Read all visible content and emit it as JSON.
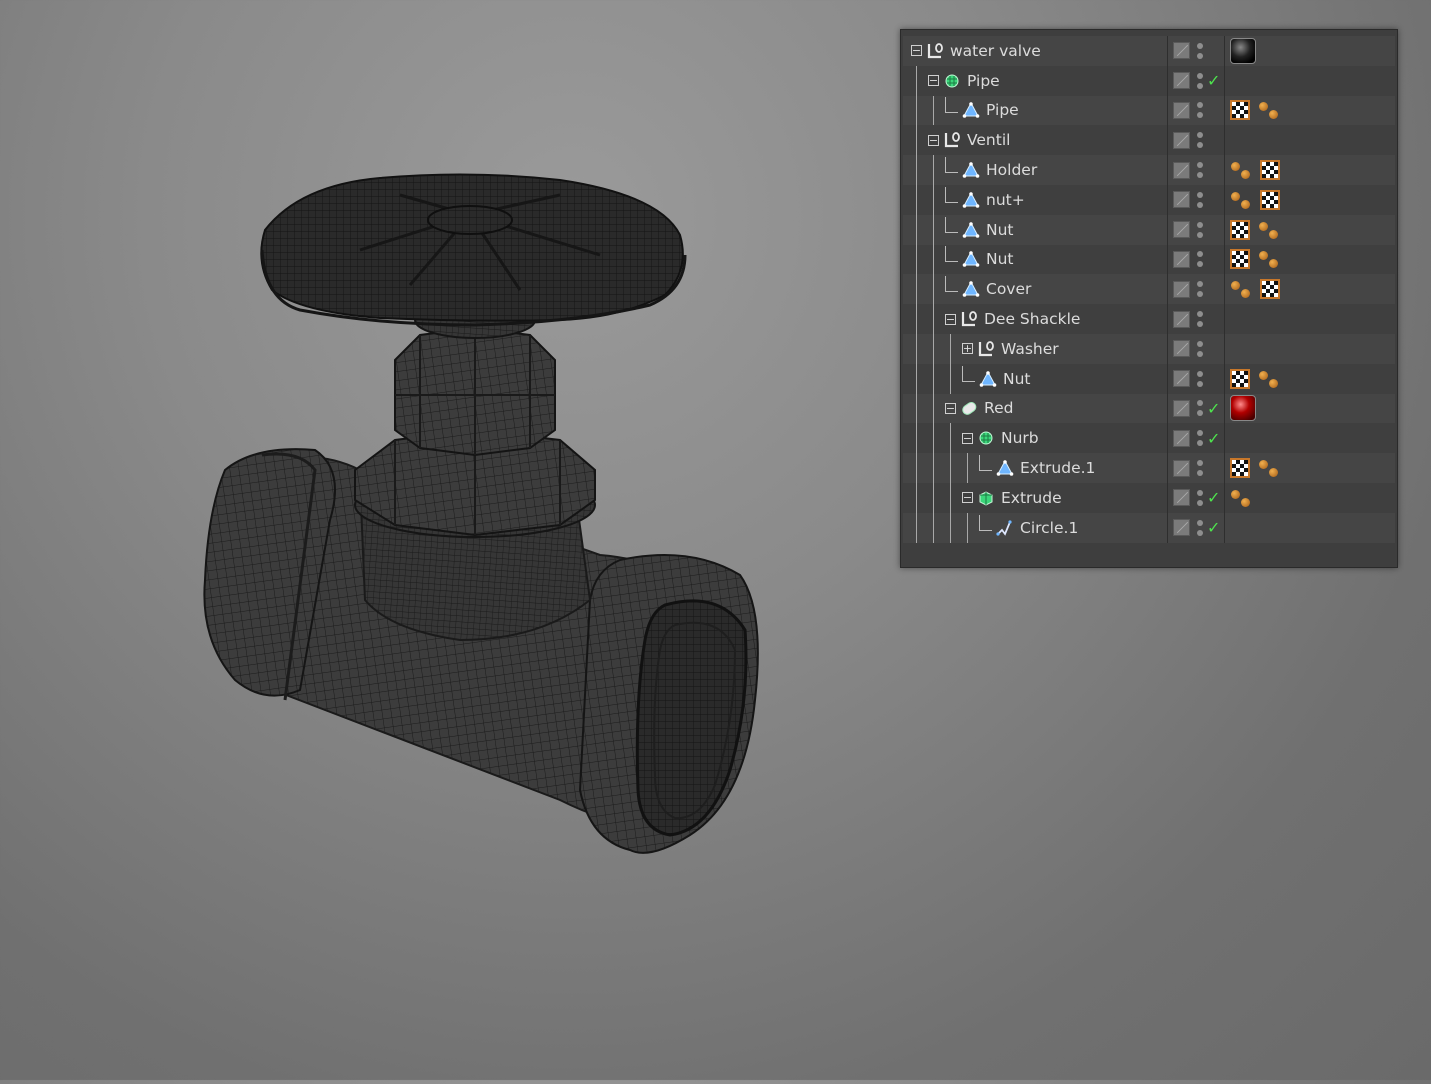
{
  "object_manager": {
    "rows": [
      {
        "label": "water valve",
        "icon": "null-object-icon",
        "depth": 0,
        "expander": "minus",
        "visible_check": false,
        "tags": [
          "material-black"
        ]
      },
      {
        "label": "Pipe",
        "icon": "subdivision-icon",
        "depth": 1,
        "expander": "minus",
        "visible_check": true,
        "tags": []
      },
      {
        "label": "Pipe",
        "icon": "polygon-icon",
        "depth": 2,
        "expander": "none",
        "visible_check": false,
        "tags": [
          "texture",
          "phong"
        ]
      },
      {
        "label": "Ventil",
        "icon": "null-object-icon",
        "depth": 1,
        "expander": "minus",
        "visible_check": false,
        "tags": []
      },
      {
        "label": "Holder",
        "icon": "polygon-icon",
        "depth": 2,
        "expander": "none",
        "visible_check": false,
        "tags": [
          "phong",
          "texture"
        ]
      },
      {
        "label": "nut+",
        "icon": "polygon-icon",
        "depth": 2,
        "expander": "none",
        "visible_check": false,
        "tags": [
          "phong",
          "texture"
        ]
      },
      {
        "label": "Nut",
        "icon": "polygon-icon",
        "depth": 2,
        "expander": "none",
        "visible_check": false,
        "tags": [
          "texture",
          "phong"
        ]
      },
      {
        "label": "Nut",
        "icon": "polygon-icon",
        "depth": 2,
        "expander": "none",
        "visible_check": false,
        "tags": [
          "texture",
          "phong"
        ]
      },
      {
        "label": "Cover",
        "icon": "polygon-icon",
        "depth": 2,
        "expander": "none",
        "visible_check": false,
        "tags": [
          "phong",
          "texture"
        ]
      },
      {
        "label": "Dee Shackle",
        "icon": "null-object-icon",
        "depth": 2,
        "expander": "minus",
        "visible_check": false,
        "tags": []
      },
      {
        "label": "Washer",
        "icon": "null-object-icon",
        "depth": 3,
        "expander": "plus",
        "visible_check": false,
        "tags": []
      },
      {
        "label": "Nut",
        "icon": "polygon-icon",
        "depth": 3,
        "expander": "none",
        "visible_check": false,
        "tags": [
          "texture",
          "phong"
        ]
      },
      {
        "label": "Red",
        "icon": "capsule-icon",
        "depth": 2,
        "expander": "minus",
        "visible_check": true,
        "tags": [
          "material-red"
        ]
      },
      {
        "label": "Nurb",
        "icon": "subdivision-icon",
        "depth": 3,
        "expander": "minus",
        "visible_check": true,
        "tags": []
      },
      {
        "label": "Extrude.1",
        "icon": "polygon-icon",
        "depth": 4,
        "expander": "none",
        "visible_check": false,
        "tags": [
          "texture",
          "phong"
        ]
      },
      {
        "label": "Extrude",
        "icon": "extrude-icon",
        "depth": 3,
        "expander": "minus",
        "visible_check": true,
        "tags": [
          "phong"
        ]
      },
      {
        "label": "Circle.1",
        "icon": "spline-icon",
        "depth": 4,
        "expander": "none",
        "visible_check": true,
        "tags": []
      }
    ]
  },
  "colors": {
    "panel_bg": "#3e3e3e",
    "check": "#4ee24e",
    "tag_orange": "#c7772a",
    "null_icon": "#e8e8e8",
    "poly_icon": "#6fb6ff",
    "subd_icon": "#3bd67a"
  }
}
